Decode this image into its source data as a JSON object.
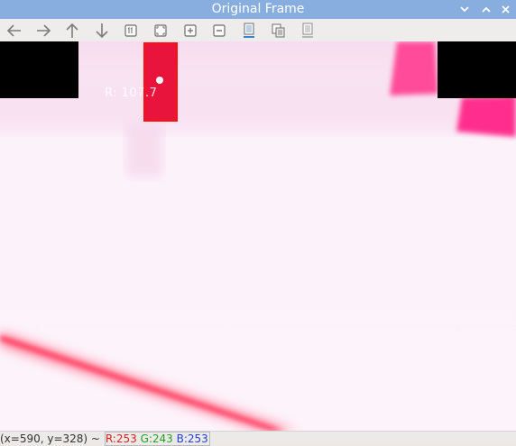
{
  "window": {
    "title": "Original Frame",
    "controls": [
      "chevron-down",
      "chevron-up",
      "close"
    ]
  },
  "toolbar": {
    "buttons": [
      {
        "name": "pan-left",
        "icon": "arrow-left-icon"
      },
      {
        "name": "pan-right",
        "icon": "arrow-right-icon"
      },
      {
        "name": "pan-up",
        "icon": "arrow-up-icon"
      },
      {
        "name": "pan-down",
        "icon": "arrow-down-icon"
      },
      {
        "name": "zoom-original",
        "icon": "zoom-original-icon"
      },
      {
        "name": "zoom-fit",
        "icon": "zoom-fit-icon"
      },
      {
        "name": "zoom-in",
        "icon": "zoom-in-icon"
      },
      {
        "name": "zoom-out",
        "icon": "zoom-out-icon"
      },
      {
        "name": "save-image",
        "icon": "save-image-icon"
      },
      {
        "name": "copy-image",
        "icon": "copy-image-icon"
      },
      {
        "name": "properties",
        "icon": "properties-icon"
      }
    ]
  },
  "frame": {
    "roi_label": "R: 107.7",
    "roi_color": "#e8143c",
    "marker_color": "#ffffff"
  },
  "status": {
    "coords": "(x=590, y=328) ~",
    "r": "R:253",
    "g": "G:243",
    "b": "B:253"
  }
}
